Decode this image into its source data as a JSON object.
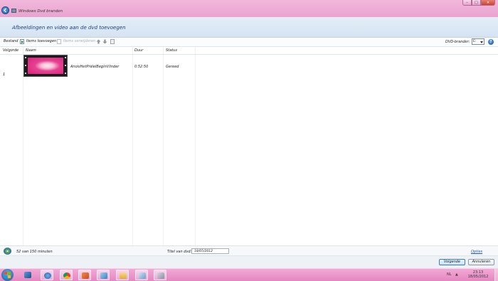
{
  "window": {
    "title": "Windows Dvd branden",
    "controls": {
      "minimize": "–",
      "maximize": "□",
      "close": "✕"
    }
  },
  "header": {
    "title": "Afbeeldingen en video aan de dvd toevoegen"
  },
  "toolbar": {
    "file_label": "Bestand",
    "add_items_label": "Items toevoegen",
    "remove_items_label": "Items verwijderen",
    "dvd_burner_label": "DVD-brander:",
    "dvd_burner_value": "E:"
  },
  "table": {
    "columns": [
      "Volgorde",
      "Naam",
      "Duur",
      "Status"
    ],
    "rows": [
      {
        "order": "1",
        "name": "AnoisHetPrälelBeginVlinder",
        "duration": "0:52:50",
        "status": "Gereed"
      }
    ]
  },
  "status": {
    "capacity": "52 van 150 minuten",
    "title_label": "Titel van dvd:",
    "title_value": "18/05/2012",
    "options_link": "Opties"
  },
  "buttons": {
    "next": "Volgende",
    "cancel": "Annuleren"
  },
  "taskbar": {
    "language": "NL",
    "time": "23:13",
    "date": "18/05/2012",
    "apps": [
      "media-player",
      "ie",
      "chrome",
      "paint",
      "windows-dvd-maker",
      "explorer",
      "notepad",
      "video-tool"
    ]
  },
  "colors": {
    "titlebar": "#e9a3cf",
    "taskbar": "#e487c1",
    "header": "#d5e3f1",
    "link": "#1e57b8"
  }
}
